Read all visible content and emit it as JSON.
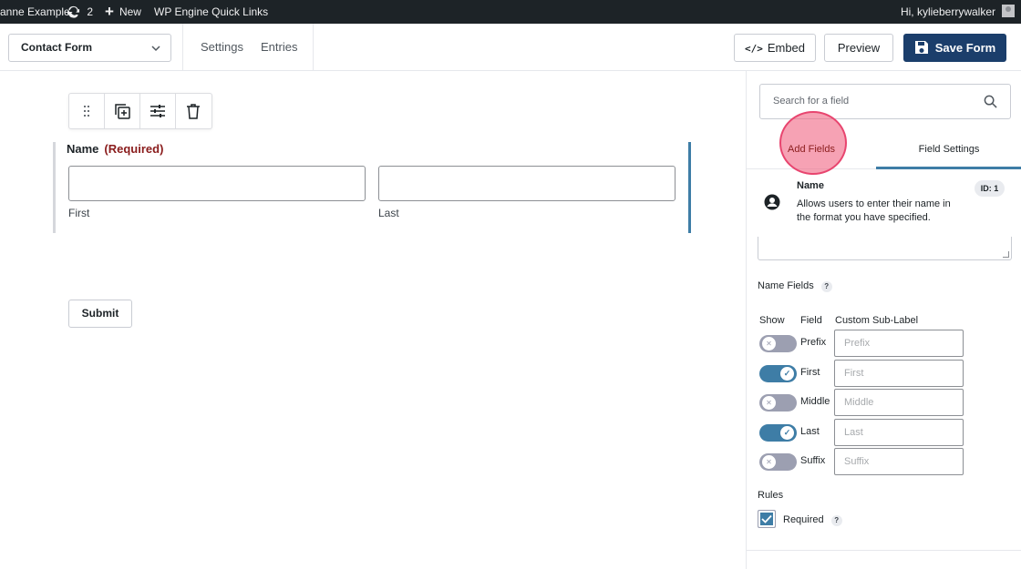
{
  "adminbar": {
    "site_name": "anne Example",
    "updates_count": "2",
    "new_label": "New",
    "quick_links": "WP Engine Quick Links",
    "howdy": "Hi, kylieberrywalker"
  },
  "toolbar": {
    "form_name": "Contact Form",
    "settings_label": "Settings",
    "entries_label": "Entries",
    "embed_label": "Embed",
    "embed_code_glyph": "</>",
    "preview_label": "Preview",
    "save_label": "Save Form",
    "save_color": "#1b3e6b"
  },
  "canvas": {
    "field_label": "Name",
    "required_label": "(Required)",
    "first_label": "First",
    "last_label": "Last",
    "submit_label": "Submit",
    "selected_color": "#3e7da6",
    "required_color": "#8a1c1c"
  },
  "sidebar": {
    "search_placeholder": "Search for a field",
    "tab_add": "Add Fields",
    "tab_settings": "Field Settings",
    "field_title": "Name",
    "field_desc": "Allows users to enter their name in the format you have specified.",
    "field_id": "ID: 1",
    "name_fields_label": "Name Fields",
    "help_glyph": "?",
    "col_show": "Show",
    "col_field": "Field",
    "col_sublabel": "Custom Sub-Label",
    "name_rows": [
      {
        "field": "Prefix",
        "placeholder": "Prefix",
        "enabled": false
      },
      {
        "field": "First",
        "placeholder": "First",
        "enabled": true
      },
      {
        "field": "Middle",
        "placeholder": "Middle",
        "enabled": false
      },
      {
        "field": "Last",
        "placeholder": "Last",
        "enabled": true
      },
      {
        "field": "Suffix",
        "placeholder": "Suffix",
        "enabled": false
      }
    ],
    "rules_label": "Rules",
    "required_label": "Required",
    "required_checked": true
  }
}
